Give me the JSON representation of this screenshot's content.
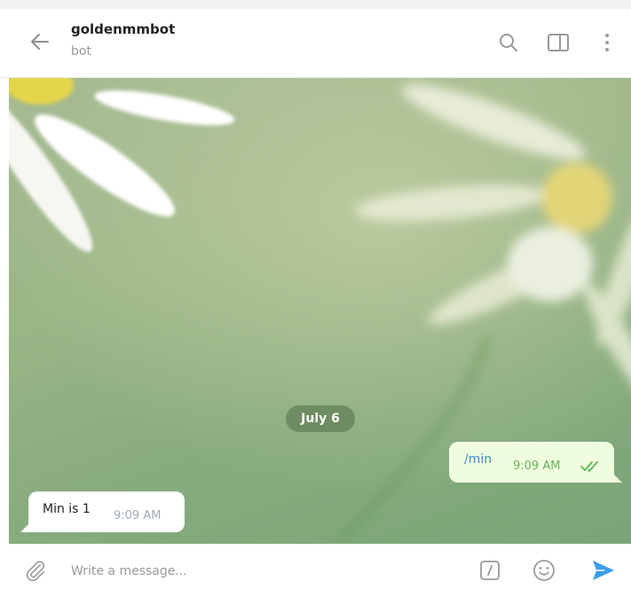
{
  "header": {
    "title": "goldenmmbot",
    "subtitle": "bot",
    "icons": [
      "back-arrow-icon",
      "search-icon",
      "sidebar-toggle-icon",
      "more-vertical-icon"
    ]
  },
  "chat": {
    "date_separator": "July 6",
    "messages": [
      {
        "direction": "outgoing",
        "text": "/min",
        "time": "9:09 AM",
        "status": "read"
      },
      {
        "direction": "incoming",
        "text": "Min is 1",
        "time": "9:09 AM"
      }
    ]
  },
  "composer": {
    "placeholder": "Write a message...",
    "icons": [
      "paperclip-icon",
      "bot-command-icon",
      "emoji-icon",
      "send-icon"
    ]
  },
  "colors": {
    "accent": "#3a9ee8",
    "outgoing_bubble": "#effdde",
    "incoming_bubble": "#ffffff",
    "read_check": "#5fb55a"
  }
}
